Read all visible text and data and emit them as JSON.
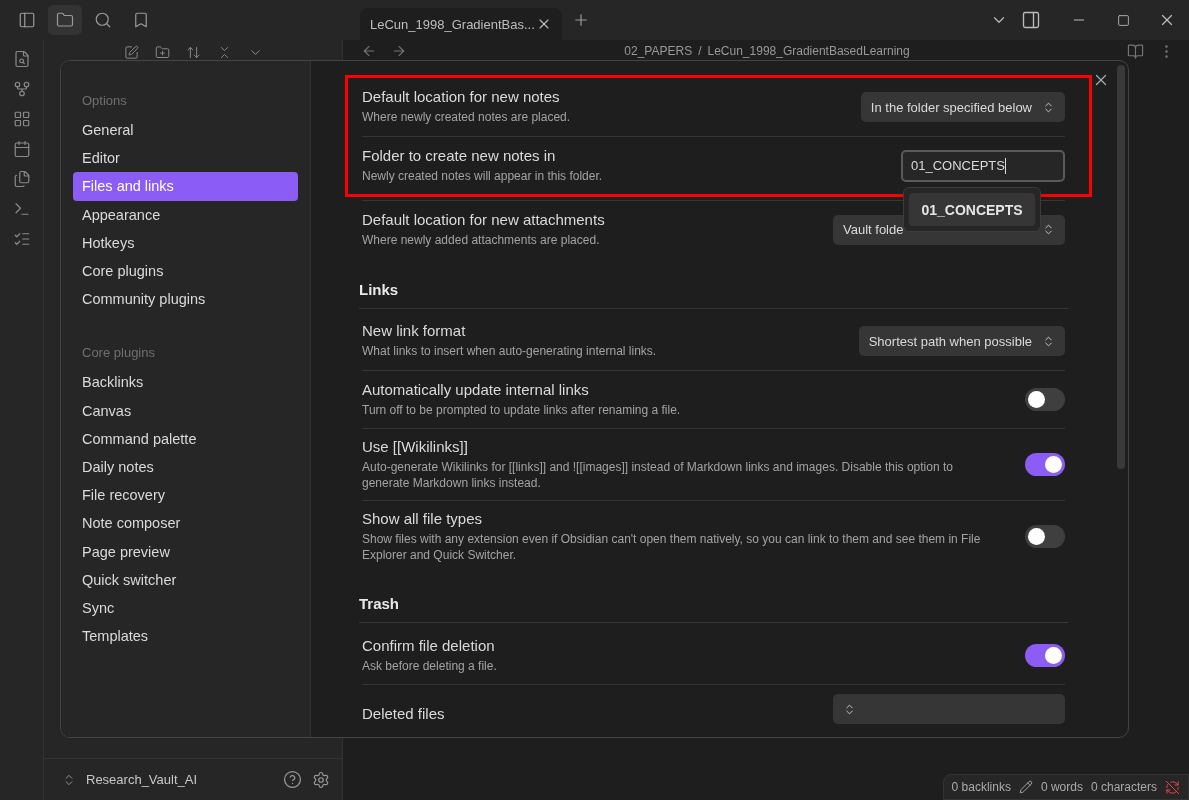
{
  "title_bar": {
    "tab_title": "LeCun_1998_GradientBas..."
  },
  "file_explorer": {
    "vault_name": "Research_Vault_AI"
  },
  "editor": {
    "breadcrumb_folder": "02_PAPERS",
    "breadcrumb_separator": "/",
    "breadcrumb_file": "LeCun_1998_GradientBasedLearning"
  },
  "status_bar": {
    "backlinks": "0 backlinks",
    "words": "0 words",
    "characters": "0 characters"
  },
  "settings": {
    "nav_sections": [
      {
        "heading": "Options",
        "items": [
          {
            "label": "General",
            "selected": false
          },
          {
            "label": "Editor",
            "selected": false
          },
          {
            "label": "Files and links",
            "selected": true
          },
          {
            "label": "Appearance",
            "selected": false
          },
          {
            "label": "Hotkeys",
            "selected": false
          },
          {
            "label": "Core plugins",
            "selected": false
          },
          {
            "label": "Community plugins",
            "selected": false
          }
        ]
      },
      {
        "heading": "Core plugins",
        "items": [
          {
            "label": "Backlinks",
            "selected": false
          },
          {
            "label": "Canvas",
            "selected": false
          },
          {
            "label": "Command palette",
            "selected": false
          },
          {
            "label": "Daily notes",
            "selected": false
          },
          {
            "label": "File recovery",
            "selected": false
          },
          {
            "label": "Note composer",
            "selected": false
          },
          {
            "label": "Page preview",
            "selected": false
          },
          {
            "label": "Quick switcher",
            "selected": false
          },
          {
            "label": "Sync",
            "selected": false
          },
          {
            "label": "Templates",
            "selected": false
          }
        ]
      }
    ],
    "groups": [
      {
        "highlighted": true,
        "rows": [
          {
            "kind": "dropdown",
            "name": "Default location for new notes",
            "description": "Where newly created notes are placed.",
            "value": "In the folder specified below"
          },
          {
            "kind": "text",
            "name": "Folder to create new notes in",
            "description": "Newly created notes will appear in this folder.",
            "value": "01_CONCEPTS",
            "suggestion": "01_CONCEPTS"
          }
        ]
      },
      {
        "highlighted": false,
        "rows": [
          {
            "kind": "dropdown",
            "name": "Default location for new attachments",
            "description": "Where newly added attachments are placed.",
            "value": "Vault folde"
          }
        ]
      },
      {
        "highlighted": false,
        "heading": "Links",
        "rows": [
          {
            "kind": "dropdown",
            "name": "New link format",
            "description": "What links to insert when auto-generating internal links.",
            "value": "Shortest path when possible"
          },
          {
            "kind": "toggle",
            "name": "Automatically update internal links",
            "description": "Turn off to be prompted to update links after renaming a file.",
            "on": false
          },
          {
            "kind": "toggle",
            "name": "Use [[Wikilinks]]",
            "description": "Auto-generate Wikilinks for [[links]] and ![[images]] instead of Markdown links and images. Disable this option to generate Markdown links instead.",
            "on": true
          },
          {
            "kind": "toggle",
            "name": "Show all file types",
            "description": "Show files with any extension even if Obsidian can't open them natively, so you can link to them and see them in File Explorer and Quick Switcher.",
            "on": false
          }
        ]
      },
      {
        "highlighted": false,
        "heading": "Trash",
        "rows": [
          {
            "kind": "toggle",
            "name": "Confirm file deletion",
            "description": "Ask before deleting a file.",
            "on": true
          },
          {
            "kind": "dropdown",
            "name": "Deleted files"
          }
        ]
      }
    ]
  }
}
